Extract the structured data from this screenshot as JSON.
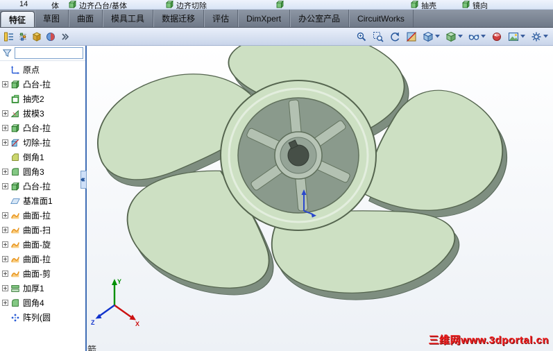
{
  "top_toolbar": {
    "partial_items": [
      {
        "label": "14",
        "icon": null
      },
      {
        "label": "体",
        "icon": null
      },
      {
        "label": "边齐凸台/基体",
        "icon": "cube"
      },
      {
        "label": "边齐切除",
        "icon": "cube"
      },
      {
        "label": "",
        "icon": "cube"
      },
      {
        "label": "抽壳",
        "icon": "cube"
      },
      {
        "label": "镜向",
        "icon": "cube"
      }
    ]
  },
  "ribbon_tabs": [
    {
      "label": "特征",
      "active": true
    },
    {
      "label": "草图",
      "active": false
    },
    {
      "label": "曲面",
      "active": false
    },
    {
      "label": "模具工具",
      "active": false
    },
    {
      "label": "数据迁移",
      "active": false
    },
    {
      "label": "评估",
      "active": false
    },
    {
      "label": "DimXpert",
      "active": false
    },
    {
      "label": "办公室产品",
      "active": false
    },
    {
      "label": "CircuitWorks",
      "active": false
    }
  ],
  "panel_tabs_icons": [
    "featuremanager-tab",
    "propertymanager-tab",
    "configurationmanager-tab",
    "displaymanager-tab",
    "panel-overflow"
  ],
  "heads_up_toolbar": [
    "zoom-to-fit",
    "zoom-to-area",
    "previous-view",
    "section-view",
    "view-orientation",
    "display-style",
    "hide-show-items",
    "edit-appearance",
    "apply-scene",
    "view-settings"
  ],
  "feature_tree": {
    "filter": {
      "value": "",
      "placeholder": ""
    },
    "items": [
      {
        "label": "原点",
        "icon": "origin",
        "expandable": false
      },
      {
        "label": "凸台-拉",
        "icon": "boss",
        "expandable": true
      },
      {
        "label": "抽壳2",
        "icon": "shell",
        "expandable": false
      },
      {
        "label": "拔模3",
        "icon": "draft",
        "expandable": true
      },
      {
        "label": "凸台-拉",
        "icon": "boss",
        "expandable": true
      },
      {
        "label": "切除-拉",
        "icon": "cut",
        "expandable": true
      },
      {
        "label": "倒角1",
        "icon": "chamfer",
        "expandable": false
      },
      {
        "label": "圆角3",
        "icon": "fillet",
        "expandable": true
      },
      {
        "label": "凸台-拉",
        "icon": "boss",
        "expandable": true
      },
      {
        "label": "基准面1",
        "icon": "plane",
        "expandable": false
      },
      {
        "label": "曲面-拉",
        "icon": "surface",
        "expandable": true
      },
      {
        "label": "曲面-扫",
        "icon": "surface",
        "expandable": true
      },
      {
        "label": "曲面-旋",
        "icon": "surface",
        "expandable": true
      },
      {
        "label": "曲面-拉",
        "icon": "surface",
        "expandable": true
      },
      {
        "label": "曲面-剪",
        "icon": "surface",
        "expandable": true
      },
      {
        "label": "加厚1",
        "icon": "thicken",
        "expandable": true
      },
      {
        "label": "圆角4",
        "icon": "fillet",
        "expandable": true
      },
      {
        "label": "阵列(圆",
        "icon": "pattern",
        "expandable": false
      }
    ],
    "clipped_bottom_text": "箭..."
  },
  "viewport": {
    "watermark": "三维网www.3dportal.cn",
    "triad": {
      "x_label": "X",
      "y_label": "Y",
      "z_label": "Z"
    }
  },
  "colors": {
    "model_face": "#cde0c3",
    "model_face_dark": "#7e8e80",
    "model_edge": "#55654f",
    "watermark": "#f02020",
    "panel_border": "#3f6db5"
  }
}
